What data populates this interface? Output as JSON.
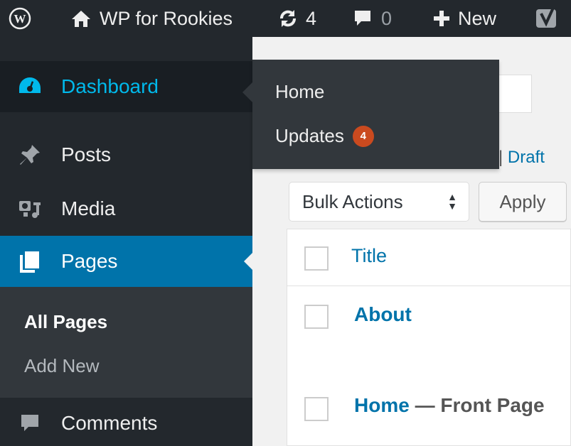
{
  "admin_bar": {
    "site_name": "WP for Rookies",
    "updates_count": "4",
    "comments_count": "0",
    "new_label": "New"
  },
  "sidebar": {
    "dashboard": "Dashboard",
    "posts": "Posts",
    "media": "Media",
    "pages": "Pages",
    "pages_submenu": [
      "All Pages",
      "Add New"
    ],
    "comments": "Comments"
  },
  "flyout": {
    "home": "Home",
    "updates": "Updates",
    "updates_badge": "4"
  },
  "main": {
    "subsubsub_sep": "|",
    "subsubsub_link": "Draft",
    "bulk_actions": "Bulk Actions",
    "apply": "Apply",
    "column_title": "Title",
    "rows": [
      {
        "title": "About",
        "state": ""
      },
      {
        "title": "Home",
        "state": "— Front Page"
      }
    ]
  },
  "colors": {
    "admin_bar": "#23282d",
    "active_menu": "#0073aa",
    "dashboard_highlight": "#00b9eb",
    "badge": "#ca4a1f",
    "link": "#0073aa"
  }
}
